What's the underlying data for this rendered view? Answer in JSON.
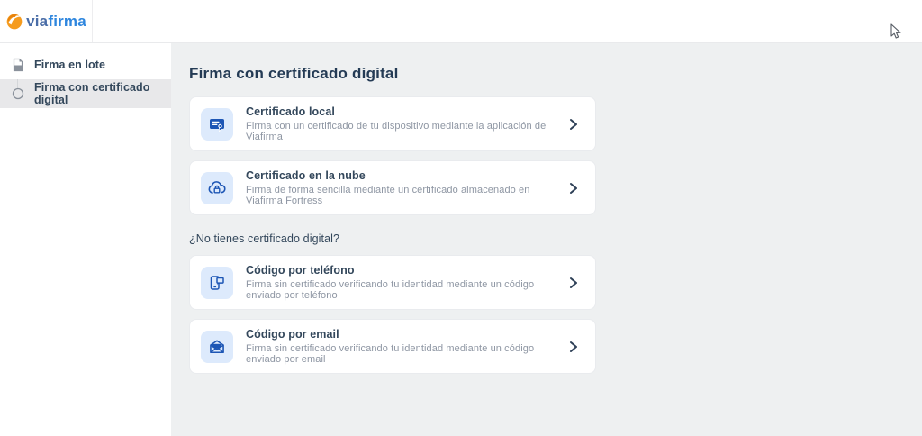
{
  "header": {
    "logo": {
      "via": "via",
      "firma": "firma",
      "icon": "viafirma-swirl-icon"
    }
  },
  "sidebar": {
    "items": [
      {
        "label": "Firma en lote",
        "icon": "batch-document-icon",
        "active": false
      },
      {
        "label": "Firma con certificado digital",
        "icon": "step-circle-icon",
        "active": true
      }
    ]
  },
  "main": {
    "title": "Firma con certificado digital",
    "section_label": "¿No tienes certificado digital?",
    "cards": [
      {
        "title": "Certificado local",
        "description": "Firma con un certificado de tu dispositivo mediante la aplicación de Viafirma",
        "icon": "certificate-icon"
      },
      {
        "title": "Certificado en la nube",
        "description": "Firma de forma sencilla mediante un certificado almacenado en Viafirma Fortress",
        "icon": "cloud-lock-icon"
      },
      {
        "title": "Código por teléfono",
        "description": "Firma sin certificado verificando tu identidad mediante un código enviado por teléfono",
        "icon": "phone-code-icon"
      },
      {
        "title": "Código por email",
        "description": "Firma sin certificado verificando tu identidad mediante un código enviado por email",
        "icon": "email-code-icon"
      }
    ]
  },
  "colors": {
    "accent_blue": "#1d56b5",
    "icon_bg": "#ddeafc",
    "navy_text": "#243b55",
    "card_title": "#33475b",
    "description_gray": "#8e96a3",
    "main_bg": "#eef0f1",
    "active_item_bg": "#e8e8ea",
    "logo_orange": "#f59b1e",
    "logo_via": "#4a6da7",
    "logo_firma": "#2e86de"
  }
}
